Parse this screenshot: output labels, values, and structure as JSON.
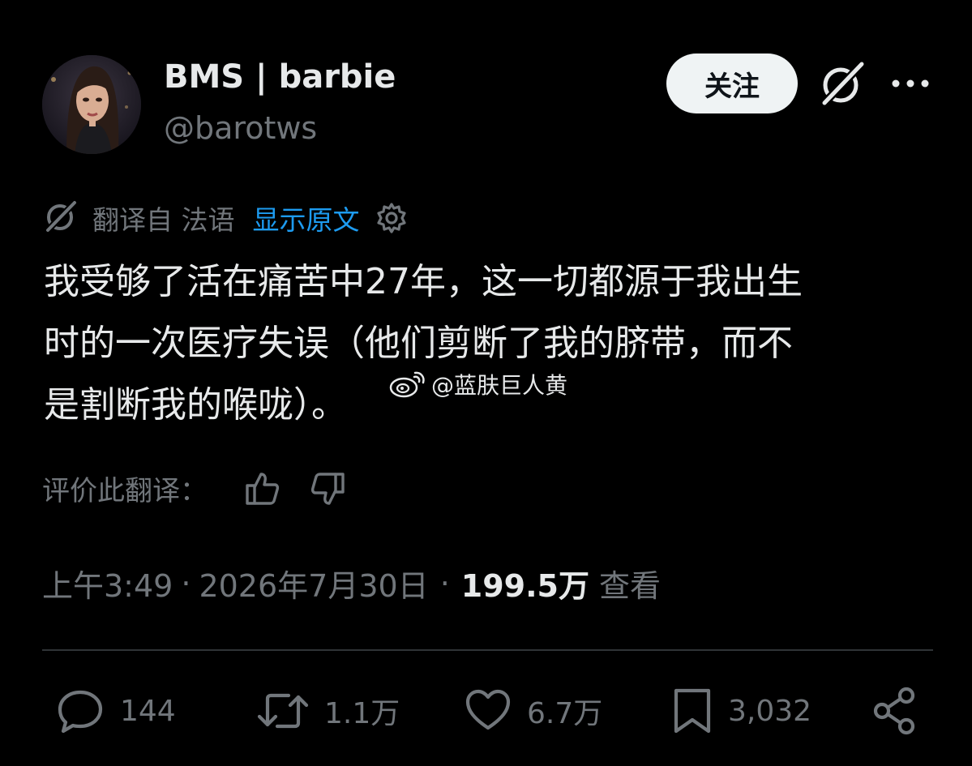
{
  "author": {
    "display_name": "BMS | barbie",
    "handle": "@barotws",
    "avatar_icon": "avatar-woman-portrait"
  },
  "header": {
    "follow_label": "关注",
    "grok_icon": "grok-icon",
    "more_icon": "more-icon"
  },
  "translation": {
    "translated_from": "翻译自 法语",
    "show_original": "显示原文",
    "settings_icon": "gear-icon"
  },
  "tweet": {
    "lines": [
      "我受够了活在痛苦中27年，这一切都源于我出生",
      "时的一次医疗失误（他们剪断了我的脐带，而不",
      "是割断我的喉咙）。"
    ]
  },
  "watermark": {
    "icon": "weibo-icon",
    "text": "@蓝肤巨人黄"
  },
  "rating": {
    "label": "评价此翻译："
  },
  "meta": {
    "time": "上午3:49",
    "date": "2026年7月30日",
    "separator": "·",
    "views_count": "199.5万",
    "views_label": "查看"
  },
  "actions": {
    "replies": "144",
    "reposts": "1.1万",
    "likes": "6.7万",
    "bookmarks": "3,032"
  },
  "colors": {
    "background": "#000000",
    "text": "#e7e9ea",
    "muted": "#71767b",
    "link": "#1d9bf0",
    "divider": "#2f3336"
  }
}
